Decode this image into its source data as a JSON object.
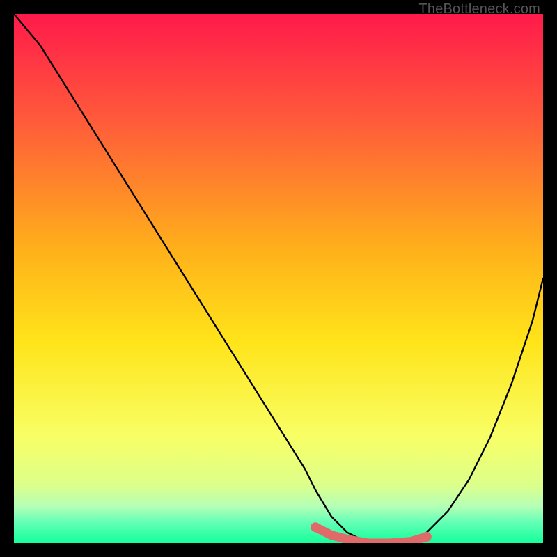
{
  "watermark": "TheBottleneck.com",
  "chart_data": {
    "type": "line",
    "title": "",
    "xlabel": "",
    "ylabel": "",
    "xlim": [
      0,
      100
    ],
    "ylim": [
      0,
      100
    ],
    "grid": false,
    "background_gradient": {
      "stops": [
        {
          "pct": 0,
          "color": "#ff1a4b"
        },
        {
          "pct": 20,
          "color": "#ff5a3a"
        },
        {
          "pct": 45,
          "color": "#ffb21a"
        },
        {
          "pct": 62,
          "color": "#ffe41a"
        },
        {
          "pct": 80,
          "color": "#f8ff66"
        },
        {
          "pct": 89,
          "color": "#dcff8a"
        },
        {
          "pct": 93,
          "color": "#b6ffb6"
        },
        {
          "pct": 96,
          "color": "#66ffb6"
        },
        {
          "pct": 100,
          "color": "#12ff9a"
        }
      ]
    },
    "series": [
      {
        "name": "bottleneck-curve",
        "color": "#000000",
        "x": [
          0,
          5,
          10,
          15,
          20,
          25,
          30,
          35,
          40,
          45,
          50,
          55,
          57,
          60,
          63,
          67,
          71,
          75,
          78,
          82,
          86,
          90,
          94,
          98,
          100
        ],
        "y": [
          100,
          94,
          86,
          78,
          70,
          62,
          54,
          46,
          38,
          30,
          22,
          14,
          10,
          5,
          2,
          0,
          0,
          0,
          2,
          6,
          12,
          20,
          30,
          42,
          50
        ]
      },
      {
        "name": "optimal-range",
        "color": "#e06a6a",
        "x": [
          57,
          60,
          63,
          67,
          71,
          75,
          78
        ],
        "y": [
          3,
          1.5,
          0.7,
          0,
          0,
          0.3,
          1.2
        ]
      }
    ],
    "markers": [
      {
        "name": "range-start",
        "x": 57,
        "y": 3,
        "color": "#e06a6a"
      },
      {
        "name": "range-end",
        "x": 78,
        "y": 1.2,
        "color": "#e06a6a"
      }
    ]
  }
}
